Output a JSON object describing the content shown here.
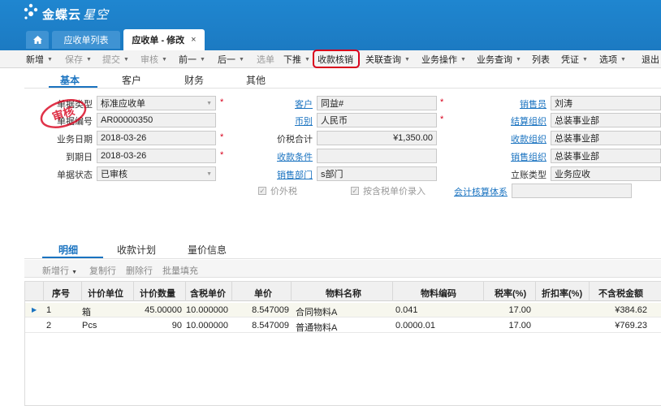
{
  "app": {
    "brand": "金蝶云",
    "product": "星空"
  },
  "window_tabs": [
    {
      "label": "应收单列表"
    },
    {
      "label": "应收单 - 修改",
      "close": "×"
    }
  ],
  "toolbar": {
    "items": [
      {
        "label": "新增",
        "dropdown": true,
        "disabled": false
      },
      {
        "label": "保存",
        "dropdown": true,
        "disabled": true
      },
      {
        "label": "提交",
        "dropdown": true,
        "disabled": true
      },
      {
        "label": "审核",
        "dropdown": true,
        "disabled": true
      },
      {
        "label": "前一",
        "dropdown": true,
        "disabled": false
      },
      {
        "label": "后一",
        "dropdown": true,
        "disabled": false
      },
      {
        "label": "选单",
        "dropdown": false,
        "disabled": true
      },
      {
        "label": "下推",
        "dropdown": true,
        "disabled": false
      },
      {
        "label": "收款核销",
        "dropdown": false,
        "disabled": false,
        "highlighted": true
      },
      {
        "label": "关联查询",
        "dropdown": true,
        "disabled": false
      },
      {
        "label": "业务操作",
        "dropdown": true,
        "disabled": false
      },
      {
        "label": "业务查询",
        "dropdown": true,
        "disabled": false
      },
      {
        "label": "列表",
        "dropdown": false,
        "disabled": false
      },
      {
        "label": "凭证",
        "dropdown": true,
        "disabled": false
      },
      {
        "label": "选项",
        "dropdown": true,
        "disabled": false
      },
      {
        "label": "退出",
        "dropdown": false,
        "disabled": false
      }
    ]
  },
  "header_tabs": [
    "基本",
    "客户",
    "财务",
    "其他"
  ],
  "form": {
    "bill_type": {
      "label": "单据类型",
      "value": "标准应收单"
    },
    "bill_no": {
      "label": "单据编号",
      "value": "AR00000350"
    },
    "biz_date": {
      "label": "业务日期",
      "value": "2018-03-26"
    },
    "due_date": {
      "label": "到期日",
      "value": "2018-03-26"
    },
    "status": {
      "label": "单据状态",
      "value": "已审核"
    },
    "customer": {
      "label": "客户",
      "value": "同益#"
    },
    "currency": {
      "label": "币别",
      "value": "人民币"
    },
    "total": {
      "label": "价税合计",
      "value": "¥1,350.00"
    },
    "pay_terms": {
      "label": "收款条件",
      "value": ""
    },
    "sales_dept": {
      "label": "销售部门",
      "value": "s部门"
    },
    "price_excl_tax": {
      "label": "价外税",
      "checked": true
    },
    "price_incl_tax_entry": {
      "label": "按含税单价录入",
      "checked": true
    },
    "salesperson": {
      "label": "销售员",
      "value": "刘涛"
    },
    "settle_org": {
      "label": "结算组织",
      "value": "总装事业部"
    },
    "collect_org": {
      "label": "收款组织",
      "value": "总装事业部"
    },
    "sales_org": {
      "label": "销售组织",
      "value": "总装事业部"
    },
    "account_type": {
      "label": "立账类型",
      "value": "业务应收"
    },
    "acct_system": {
      "label": "会计核算体系",
      "value": ""
    }
  },
  "stamp_text": "审核",
  "detail_tabs": [
    "明细",
    "收款计划",
    "量价信息"
  ],
  "detail_toolbar": [
    "新增行",
    "复制行",
    "删除行",
    "批量填充"
  ],
  "grid": {
    "columns": [
      "序号",
      "计价单位",
      "计价数量",
      "含税单价",
      "单价",
      "物料名称",
      "物料编码",
      "税率(%)",
      "折扣率(%)",
      "不含税金额"
    ],
    "rows": [
      [
        "1",
        "箱",
        "45.00000",
        "10.000000",
        "8.547009",
        "合同物料A",
        "0.041",
        "17.00",
        "",
        "¥384.62"
      ],
      [
        "2",
        "Pcs",
        "90",
        "10.000000",
        "8.547009",
        "普通物料A",
        "0.0000.01",
        "17.00",
        "",
        "¥769.23"
      ]
    ]
  },
  "colors": {
    "brand_blue": "#1c7ac2",
    "link": "#1a73c0",
    "highlight": "#d8001c"
  }
}
